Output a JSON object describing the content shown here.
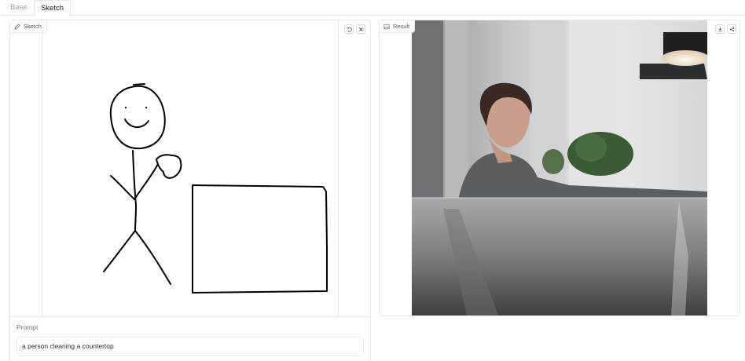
{
  "tabs": [
    {
      "label": "Base",
      "active": false
    },
    {
      "label": "Sketch",
      "active": true
    }
  ],
  "sketch_panel": {
    "label": "Sketch",
    "icons": [
      "pencil-icon",
      "undo-icon",
      "clear-icon"
    ]
  },
  "prompt": {
    "label": "Prompt",
    "value": "a person cleaning a countertop"
  },
  "result_panel": {
    "label": "Result",
    "icons": [
      "image-icon",
      "download-icon",
      "share-icon"
    ]
  },
  "colors": {
    "border": "#e5e7eb",
    "stroke": "#000000",
    "label_text": "#4b5563",
    "inactive_tab": "#9ca3af"
  }
}
